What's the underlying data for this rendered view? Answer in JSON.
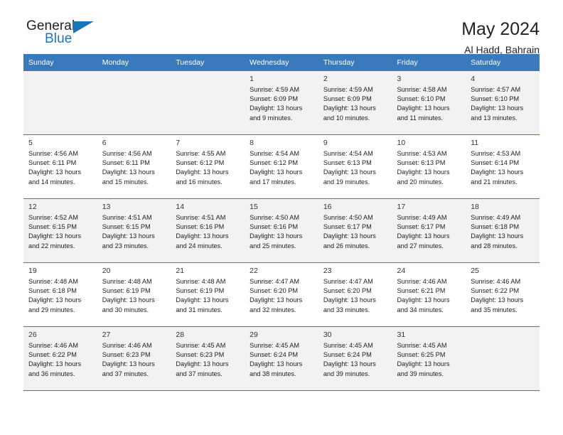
{
  "brand": {
    "name_top": "General",
    "name_bottom": "Blue",
    "accent_color": "#1b75bb"
  },
  "header": {
    "title": "May 2024",
    "subtitle": "Al Hadd, Bahrain"
  },
  "calendar": {
    "header_bg": "#3b79bd",
    "shaded_row_bg": "#f2f2f2",
    "weekdays": [
      "Sunday",
      "Monday",
      "Tuesday",
      "Wednesday",
      "Thursday",
      "Friday",
      "Saturday"
    ],
    "labels": {
      "sunrise": "Sunrise:",
      "sunset": "Sunset:",
      "daylight": "Daylight:"
    },
    "weeks": [
      [
        {
          "day": "",
          "sunrise": "",
          "sunset": "",
          "daylight_line1": "",
          "daylight_line2": ""
        },
        {
          "day": "",
          "sunrise": "",
          "sunset": "",
          "daylight_line1": "",
          "daylight_line2": ""
        },
        {
          "day": "",
          "sunrise": "",
          "sunset": "",
          "daylight_line1": "",
          "daylight_line2": ""
        },
        {
          "day": "1",
          "sunrise": "Sunrise: 4:59 AM",
          "sunset": "Sunset: 6:09 PM",
          "daylight_line1": "Daylight: 13 hours",
          "daylight_line2": "and 9 minutes."
        },
        {
          "day": "2",
          "sunrise": "Sunrise: 4:59 AM",
          "sunset": "Sunset: 6:09 PM",
          "daylight_line1": "Daylight: 13 hours",
          "daylight_line2": "and 10 minutes."
        },
        {
          "day": "3",
          "sunrise": "Sunrise: 4:58 AM",
          "sunset": "Sunset: 6:10 PM",
          "daylight_line1": "Daylight: 13 hours",
          "daylight_line2": "and 11 minutes."
        },
        {
          "day": "4",
          "sunrise": "Sunrise: 4:57 AM",
          "sunset": "Sunset: 6:10 PM",
          "daylight_line1": "Daylight: 13 hours",
          "daylight_line2": "and 13 minutes."
        }
      ],
      [
        {
          "day": "5",
          "sunrise": "Sunrise: 4:56 AM",
          "sunset": "Sunset: 6:11 PM",
          "daylight_line1": "Daylight: 13 hours",
          "daylight_line2": "and 14 minutes."
        },
        {
          "day": "6",
          "sunrise": "Sunrise: 4:56 AM",
          "sunset": "Sunset: 6:11 PM",
          "daylight_line1": "Daylight: 13 hours",
          "daylight_line2": "and 15 minutes."
        },
        {
          "day": "7",
          "sunrise": "Sunrise: 4:55 AM",
          "sunset": "Sunset: 6:12 PM",
          "daylight_line1": "Daylight: 13 hours",
          "daylight_line2": "and 16 minutes."
        },
        {
          "day": "8",
          "sunrise": "Sunrise: 4:54 AM",
          "sunset": "Sunset: 6:12 PM",
          "daylight_line1": "Daylight: 13 hours",
          "daylight_line2": "and 17 minutes."
        },
        {
          "day": "9",
          "sunrise": "Sunrise: 4:54 AM",
          "sunset": "Sunset: 6:13 PM",
          "daylight_line1": "Daylight: 13 hours",
          "daylight_line2": "and 19 minutes."
        },
        {
          "day": "10",
          "sunrise": "Sunrise: 4:53 AM",
          "sunset": "Sunset: 6:13 PM",
          "daylight_line1": "Daylight: 13 hours",
          "daylight_line2": "and 20 minutes."
        },
        {
          "day": "11",
          "sunrise": "Sunrise: 4:53 AM",
          "sunset": "Sunset: 6:14 PM",
          "daylight_line1": "Daylight: 13 hours",
          "daylight_line2": "and 21 minutes."
        }
      ],
      [
        {
          "day": "12",
          "sunrise": "Sunrise: 4:52 AM",
          "sunset": "Sunset: 6:15 PM",
          "daylight_line1": "Daylight: 13 hours",
          "daylight_line2": "and 22 minutes."
        },
        {
          "day": "13",
          "sunrise": "Sunrise: 4:51 AM",
          "sunset": "Sunset: 6:15 PM",
          "daylight_line1": "Daylight: 13 hours",
          "daylight_line2": "and 23 minutes."
        },
        {
          "day": "14",
          "sunrise": "Sunrise: 4:51 AM",
          "sunset": "Sunset: 6:16 PM",
          "daylight_line1": "Daylight: 13 hours",
          "daylight_line2": "and 24 minutes."
        },
        {
          "day": "15",
          "sunrise": "Sunrise: 4:50 AM",
          "sunset": "Sunset: 6:16 PM",
          "daylight_line1": "Daylight: 13 hours",
          "daylight_line2": "and 25 minutes."
        },
        {
          "day": "16",
          "sunrise": "Sunrise: 4:50 AM",
          "sunset": "Sunset: 6:17 PM",
          "daylight_line1": "Daylight: 13 hours",
          "daylight_line2": "and 26 minutes."
        },
        {
          "day": "17",
          "sunrise": "Sunrise: 4:49 AM",
          "sunset": "Sunset: 6:17 PM",
          "daylight_line1": "Daylight: 13 hours",
          "daylight_line2": "and 27 minutes."
        },
        {
          "day": "18",
          "sunrise": "Sunrise: 4:49 AM",
          "sunset": "Sunset: 6:18 PM",
          "daylight_line1": "Daylight: 13 hours",
          "daylight_line2": "and 28 minutes."
        }
      ],
      [
        {
          "day": "19",
          "sunrise": "Sunrise: 4:48 AM",
          "sunset": "Sunset: 6:18 PM",
          "daylight_line1": "Daylight: 13 hours",
          "daylight_line2": "and 29 minutes."
        },
        {
          "day": "20",
          "sunrise": "Sunrise: 4:48 AM",
          "sunset": "Sunset: 6:19 PM",
          "daylight_line1": "Daylight: 13 hours",
          "daylight_line2": "and 30 minutes."
        },
        {
          "day": "21",
          "sunrise": "Sunrise: 4:48 AM",
          "sunset": "Sunset: 6:19 PM",
          "daylight_line1": "Daylight: 13 hours",
          "daylight_line2": "and 31 minutes."
        },
        {
          "day": "22",
          "sunrise": "Sunrise: 4:47 AM",
          "sunset": "Sunset: 6:20 PM",
          "daylight_line1": "Daylight: 13 hours",
          "daylight_line2": "and 32 minutes."
        },
        {
          "day": "23",
          "sunrise": "Sunrise: 4:47 AM",
          "sunset": "Sunset: 6:20 PM",
          "daylight_line1": "Daylight: 13 hours",
          "daylight_line2": "and 33 minutes."
        },
        {
          "day": "24",
          "sunrise": "Sunrise: 4:46 AM",
          "sunset": "Sunset: 6:21 PM",
          "daylight_line1": "Daylight: 13 hours",
          "daylight_line2": "and 34 minutes."
        },
        {
          "day": "25",
          "sunrise": "Sunrise: 4:46 AM",
          "sunset": "Sunset: 6:22 PM",
          "daylight_line1": "Daylight: 13 hours",
          "daylight_line2": "and 35 minutes."
        }
      ],
      [
        {
          "day": "26",
          "sunrise": "Sunrise: 4:46 AM",
          "sunset": "Sunset: 6:22 PM",
          "daylight_line1": "Daylight: 13 hours",
          "daylight_line2": "and 36 minutes."
        },
        {
          "day": "27",
          "sunrise": "Sunrise: 4:46 AM",
          "sunset": "Sunset: 6:23 PM",
          "daylight_line1": "Daylight: 13 hours",
          "daylight_line2": "and 37 minutes."
        },
        {
          "day": "28",
          "sunrise": "Sunrise: 4:45 AM",
          "sunset": "Sunset: 6:23 PM",
          "daylight_line1": "Daylight: 13 hours",
          "daylight_line2": "and 37 minutes."
        },
        {
          "day": "29",
          "sunrise": "Sunrise: 4:45 AM",
          "sunset": "Sunset: 6:24 PM",
          "daylight_line1": "Daylight: 13 hours",
          "daylight_line2": "and 38 minutes."
        },
        {
          "day": "30",
          "sunrise": "Sunrise: 4:45 AM",
          "sunset": "Sunset: 6:24 PM",
          "daylight_line1": "Daylight: 13 hours",
          "daylight_line2": "and 39 minutes."
        },
        {
          "day": "31",
          "sunrise": "Sunrise: 4:45 AM",
          "sunset": "Sunset: 6:25 PM",
          "daylight_line1": "Daylight: 13 hours",
          "daylight_line2": "and 39 minutes."
        },
        {
          "day": "",
          "sunrise": "",
          "sunset": "",
          "daylight_line1": "",
          "daylight_line2": ""
        }
      ]
    ]
  }
}
